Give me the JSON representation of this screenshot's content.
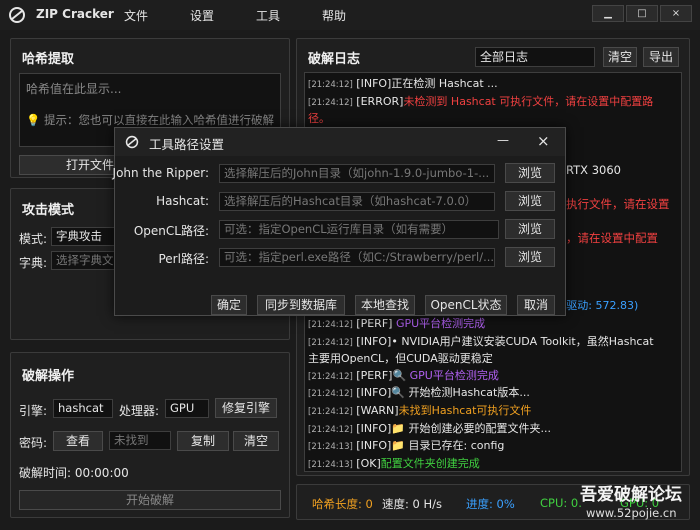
{
  "app": {
    "title": "ZIP Cracker",
    "menu": [
      "文件",
      "设置",
      "工具",
      "帮助"
    ],
    "window_controls": [
      "▁",
      "□",
      "×"
    ]
  },
  "hash_panel": {
    "title": "哈希提取",
    "placeholder": "哈希值在此显示...",
    "hint": "提示：您也可以直接在此输入哈希值进行破解",
    "open_file": "打开文件"
  },
  "attack_panel": {
    "title": "攻击模式",
    "mode_label": "模式:",
    "mode_value": "字典攻击",
    "dict_label": "字典:",
    "dict_placeholder": "选择字典文件"
  },
  "crack_panel": {
    "title": "破解操作",
    "engine_label": "引擎:",
    "engine_value": "hashcat",
    "processor_label": "处理器:",
    "processor_value": "GPU",
    "repair_button": "修复引擎",
    "password_label": "密码:",
    "view_button": "查看",
    "password_value": "未找到",
    "copy_button": "复制",
    "clear_button": "清空",
    "time_label": "破解时间: 00:00:00",
    "start_button": "开始破解"
  },
  "log_panel": {
    "title": "破解日志",
    "filter": "全部日志",
    "clear_button": "清空",
    "export_button": "导出",
    "lines_top": [
      {
        "ts": "[21:24:12]",
        "parts": [
          {
            "t": " [INFO]正在检测 Hashcat ...",
            "c": ""
          }
        ]
      },
      {
        "ts": "[21:24:12]",
        "parts": [
          {
            "t": " [ERROR]",
            "c": ""
          },
          {
            "t": "未检测到 Hashcat 可执行文件，请在设置中配置路",
            "c": "red"
          }
        ]
      },
      {
        "ts": "",
        "parts": [
          {
            "t": "径。",
            "c": "red"
          }
        ]
      }
    ],
    "lines_bottom": [
      {
        "ts": "[21:24:12]",
        "parts": [
          {
            "t": " [PERF] ",
            "c": ""
          },
          {
            "t": "GPU平台检测完成",
            "c": "purple"
          }
        ]
      },
      {
        "ts": "[21:24:12]",
        "parts": [
          {
            "t": " [INFO]• NVIDIA用户建议安装CUDA Toolkit，虽然Hashcat",
            "c": ""
          }
        ]
      },
      {
        "ts": "",
        "parts": [
          {
            "t": "主要用OpenCL，但CUDA驱动更稳定",
            "c": ""
          }
        ]
      },
      {
        "ts": "[21:24:12]",
        "parts": [
          {
            "t": " [PERF]🔍 ",
            "c": ""
          },
          {
            "t": "GPU平台检测完成",
            "c": "purple"
          }
        ]
      },
      {
        "ts": "[21:24:12]",
        "parts": [
          {
            "t": " [INFO]🔍 开始检测Hashcat版本...",
            "c": ""
          }
        ]
      },
      {
        "ts": "[21:24:12]",
        "parts": [
          {
            "t": " [WARN]",
            "c": ""
          },
          {
            "t": "未找到Hashcat可执行文件",
            "c": "orange"
          }
        ]
      },
      {
        "ts": "[21:24:12]",
        "parts": [
          {
            "t": " [INFO]📁 开始创建必要的配置文件夹...",
            "c": ""
          }
        ]
      },
      {
        "ts": "[21:24:13]",
        "parts": [
          {
            "t": " [INFO]📁 目录已存在: config",
            "c": ""
          }
        ]
      },
      {
        "ts": "[21:24:13]",
        "parts": [
          {
            "t": " [OK]",
            "c": ""
          },
          {
            "t": "配置文件夹创建完成",
            "c": "green"
          }
        ]
      }
    ],
    "partial_right": [
      "RTX 3060",
      "执行文件，请在设置",
      "，请在设置中配置",
      "(驱动: 572.83)"
    ]
  },
  "status": {
    "hash_len": "哈希长度: 0",
    "speed": "速度: 0 H/s",
    "progress": "进度: 0%",
    "cpu": "CPU: 0.",
    "gpu": "GPU: 0",
    "watermark_main": "吾爱破解论坛",
    "watermark_sub": "www.52pojie.cn"
  },
  "dialog": {
    "title": "工具路径设置",
    "minimize": "—",
    "close": "×",
    "rows": [
      {
        "label": "John the Ripper:",
        "placeholder": "选择解压后的John目录（如john-1.9.0-jumbo-1-...",
        "browse": "浏览"
      },
      {
        "label": "Hashcat:",
        "placeholder": "选择解压后的Hashcat目录（如hashcat-7.0.0）",
        "browse": "浏览"
      },
      {
        "label": "OpenCL路径:",
        "placeholder": "可选：指定OpenCL运行库目录（如有需要）",
        "browse": "浏览"
      },
      {
        "label": "Perl路径:",
        "placeholder": "可选：指定perl.exe路径（如C:/Strawberry/perl/...",
        "browse": "浏览"
      }
    ],
    "buttons": [
      "确定",
      "同步到数据库",
      "本地查找",
      "OpenCL状态",
      "取消"
    ]
  },
  "colors": {
    "accent": "#3aa0ff",
    "error": "#f04040",
    "warn": "#f0a020",
    "ok": "#40d040",
    "perf": "#b060f0"
  }
}
